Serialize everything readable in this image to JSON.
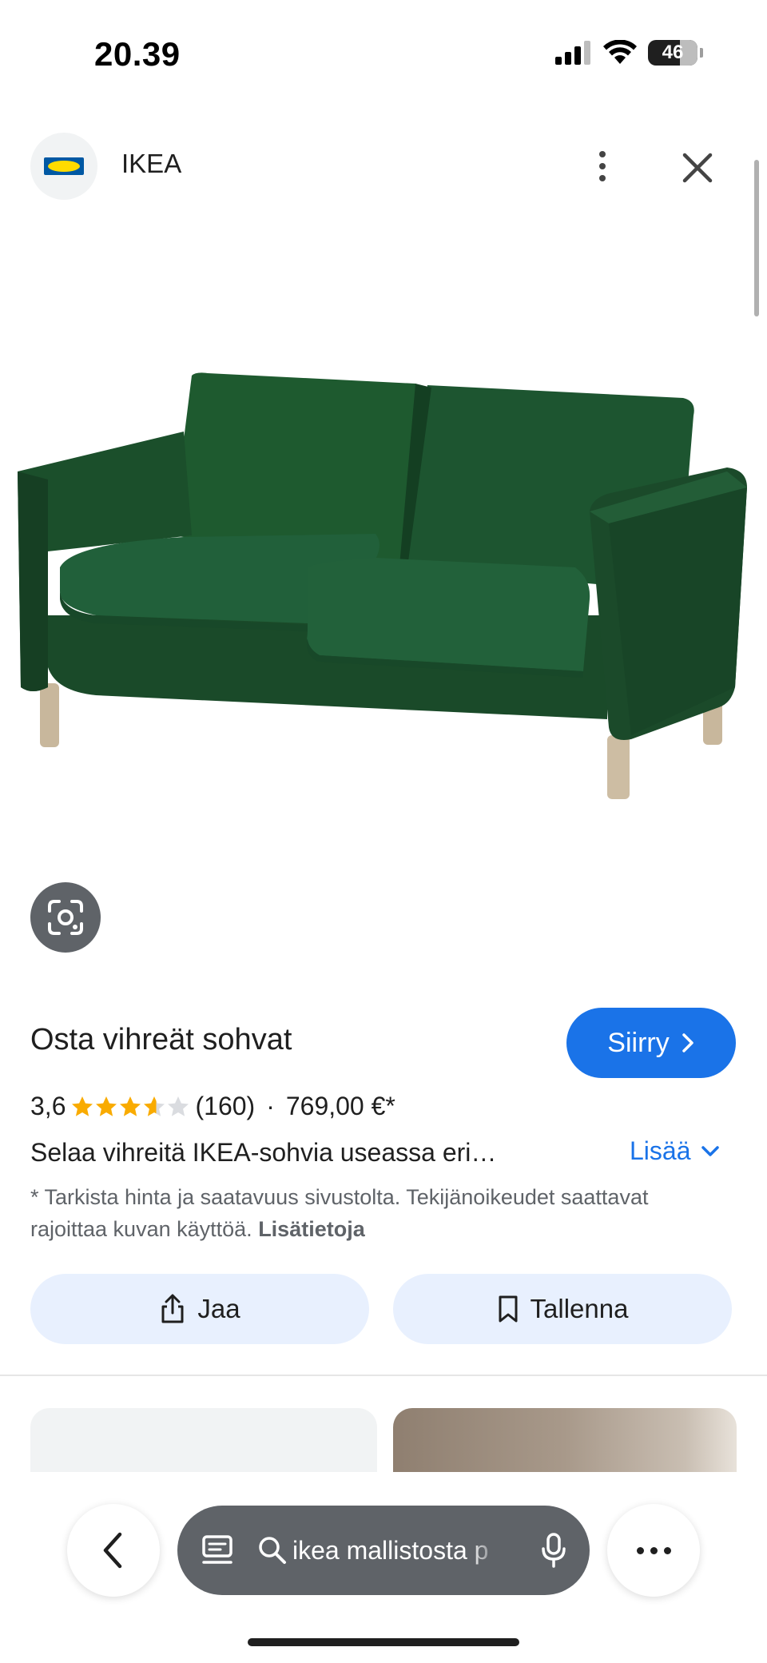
{
  "status_bar": {
    "time": "20.39",
    "battery": "46",
    "icons": [
      "cellular-signal-icon",
      "wifi-icon",
      "battery-icon"
    ]
  },
  "header": {
    "site_name": "IKEA",
    "logo": "ikea-logo",
    "menu_icon": "more-vertical-icon",
    "close_icon": "close-icon"
  },
  "product": {
    "image": "green-two-seat-sofa",
    "lens_icon": "google-lens-icon",
    "title": "Osta vihreät sohvat",
    "visit_label": "Siirry",
    "rating": "3,6",
    "rating_value": 3.6,
    "rating_max": 5,
    "review_count": "(160)",
    "separator": "·",
    "price": "769,00 €*",
    "description": "Selaa vihreitä IKEA-sohvia useassa eri…",
    "more_label": "Lisää",
    "disclaimer": "* Tarkista hinta ja saatavuus sivustolta. Tekijänoikeudet saattavat rajoittaa kuvan käyttöä.",
    "disclaimer_link": "Lisätietoja"
  },
  "actions": {
    "share_label": "Jaa",
    "save_label": "Tallenna"
  },
  "bottom_bar": {
    "search_query": "ikea mallistosta p",
    "back_icon": "chevron-left-icon",
    "tabs_icon": "tabs-icon",
    "search_icon": "search-icon",
    "mic_icon": "microphone-icon",
    "more_icon": "more-horizontal-icon"
  },
  "colors": {
    "accent": "#1a73e8",
    "chip_bg": "#e8f0fe",
    "star": "#f9ab00",
    "sofa": "#1f4d2b"
  }
}
